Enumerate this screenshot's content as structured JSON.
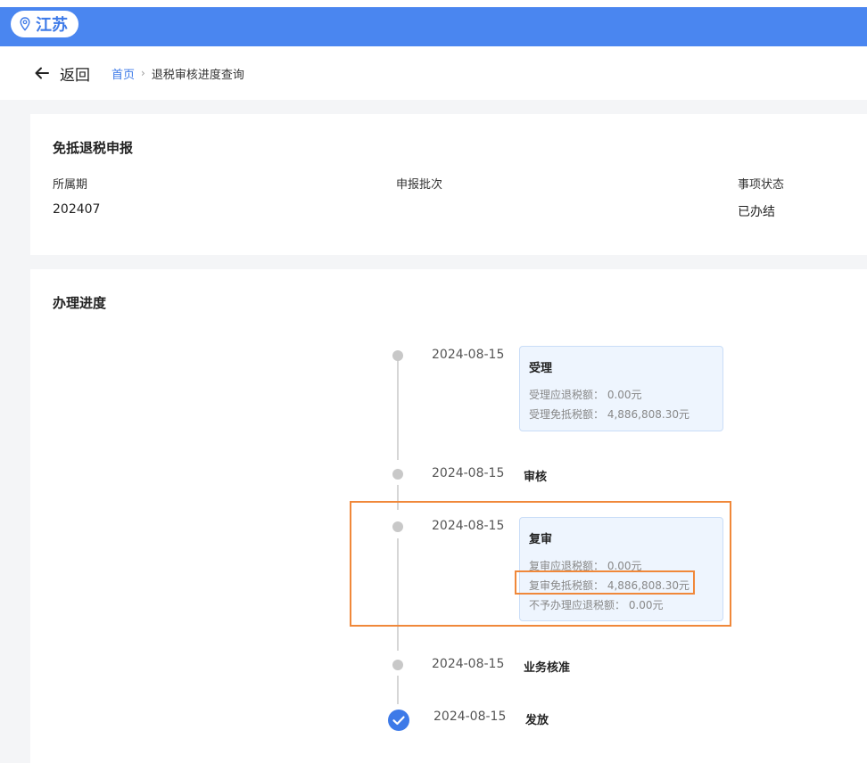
{
  "header": {
    "province": "江苏",
    "accent_color": "#4a86f0",
    "pin_icon": "location-pin-icon"
  },
  "nav": {
    "back_label": "返回",
    "breadcrumb": {
      "home": "首页",
      "separator": "›",
      "current": "退税审核进度查询"
    }
  },
  "declaration": {
    "title": "免抵退税申报",
    "fields": [
      {
        "label": "所属期",
        "value": "202407"
      },
      {
        "label": "申报批次",
        "value": ""
      },
      {
        "label": "事项状态",
        "value": "已办结"
      }
    ]
  },
  "progress": {
    "title": "办理进度",
    "steps": [
      {
        "date": "2024-08-15",
        "title": "受理",
        "lines": [
          "受理应退税额：  0.00元",
          "受理免抵税额：  4,886,808.30元"
        ]
      },
      {
        "date": "2024-08-15",
        "title": "审核"
      },
      {
        "date": "2024-08-15",
        "title": "复审",
        "lines": [
          "复审应退税额：  0.00元",
          "复审免抵税额：  4,886,808.30元",
          "不予办理应退税额：  0.00元"
        ]
      },
      {
        "date": "2024-08-15",
        "title": "业务核准"
      },
      {
        "date": "2024-08-15",
        "title": "发放",
        "status": "completed"
      }
    ]
  },
  "highlight_color": "#f0883a"
}
